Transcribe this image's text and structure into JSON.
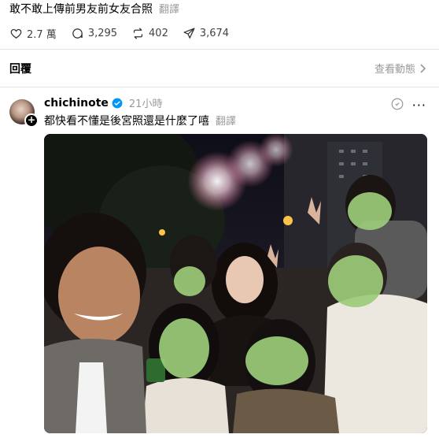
{
  "post": {
    "text": "敢不敢上傳前男友前女友合照",
    "translate": "翻譯"
  },
  "stats": {
    "likes": "2.7 萬",
    "comments": "3,295",
    "reposts": "402",
    "shares": "3,674"
  },
  "replies": {
    "title": "回覆",
    "view_activity": "查看動態"
  },
  "reply": {
    "username": "chichinote",
    "time": "21小時",
    "text": "都快看不懂是後宮照還是什麼了嘻",
    "translate": "翻譯"
  },
  "icons": [
    "heart-icon",
    "comment-icon",
    "repost-icon",
    "share-icon",
    "chevron-right-icon",
    "verified-icon",
    "plus-icon",
    "more-icon"
  ],
  "colors": {
    "verified": "#0095f6",
    "blur_overlay": "#9ccc7a"
  }
}
